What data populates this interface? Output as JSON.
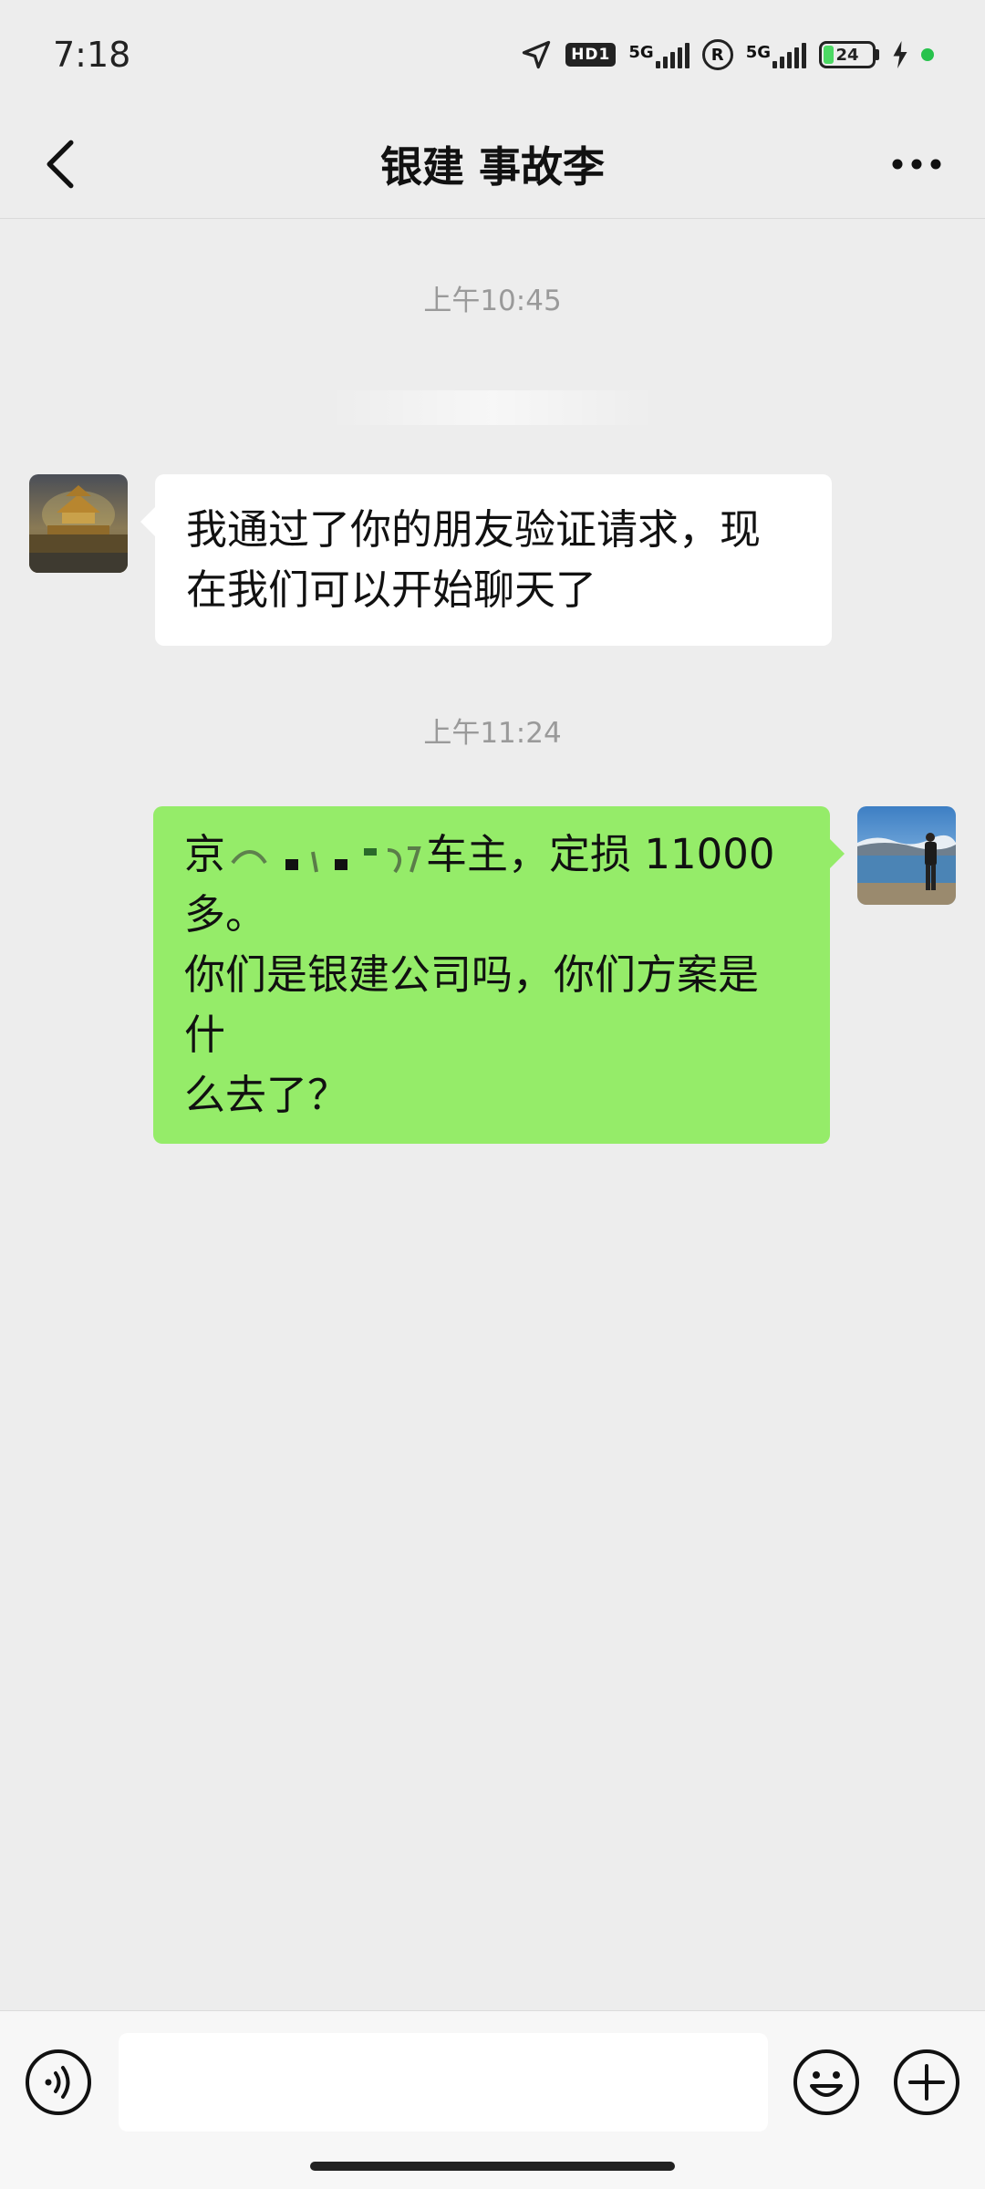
{
  "status_bar": {
    "time": "7:18",
    "hd_label": "HD1",
    "net1_label": "5G",
    "roaming_label": "R",
    "net2_label": "5G",
    "battery": "24",
    "battery_level": 0.24
  },
  "header": {
    "title": "银建 事故李"
  },
  "messages": [
    {
      "timestamp": "上午10:45",
      "direction": "incoming",
      "text": "我通过了你的朋友验证请求，现在我们可以开始聊天了"
    },
    {
      "timestamp": "上午11:24",
      "direction": "outgoing",
      "line1_prefix": "京",
      "line1_suffix": "车主，定损 11000 多。",
      "line2": "你们是银建公司吗，你们方案是什",
      "line3": "么去了？"
    }
  ],
  "input": {
    "value": "",
    "placeholder": ""
  },
  "icons": {
    "back": "chevron-left-icon",
    "more": "more-horizontal-icon",
    "voice": "voice-icon",
    "emoji": "emoji-icon",
    "add": "plus-icon"
  },
  "colors": {
    "background": "#ededed",
    "outgoing_bubble": "#95ec69",
    "incoming_bubble": "#ffffff",
    "timestamp": "#9a9a9a",
    "battery_fill": "#4cd964"
  }
}
